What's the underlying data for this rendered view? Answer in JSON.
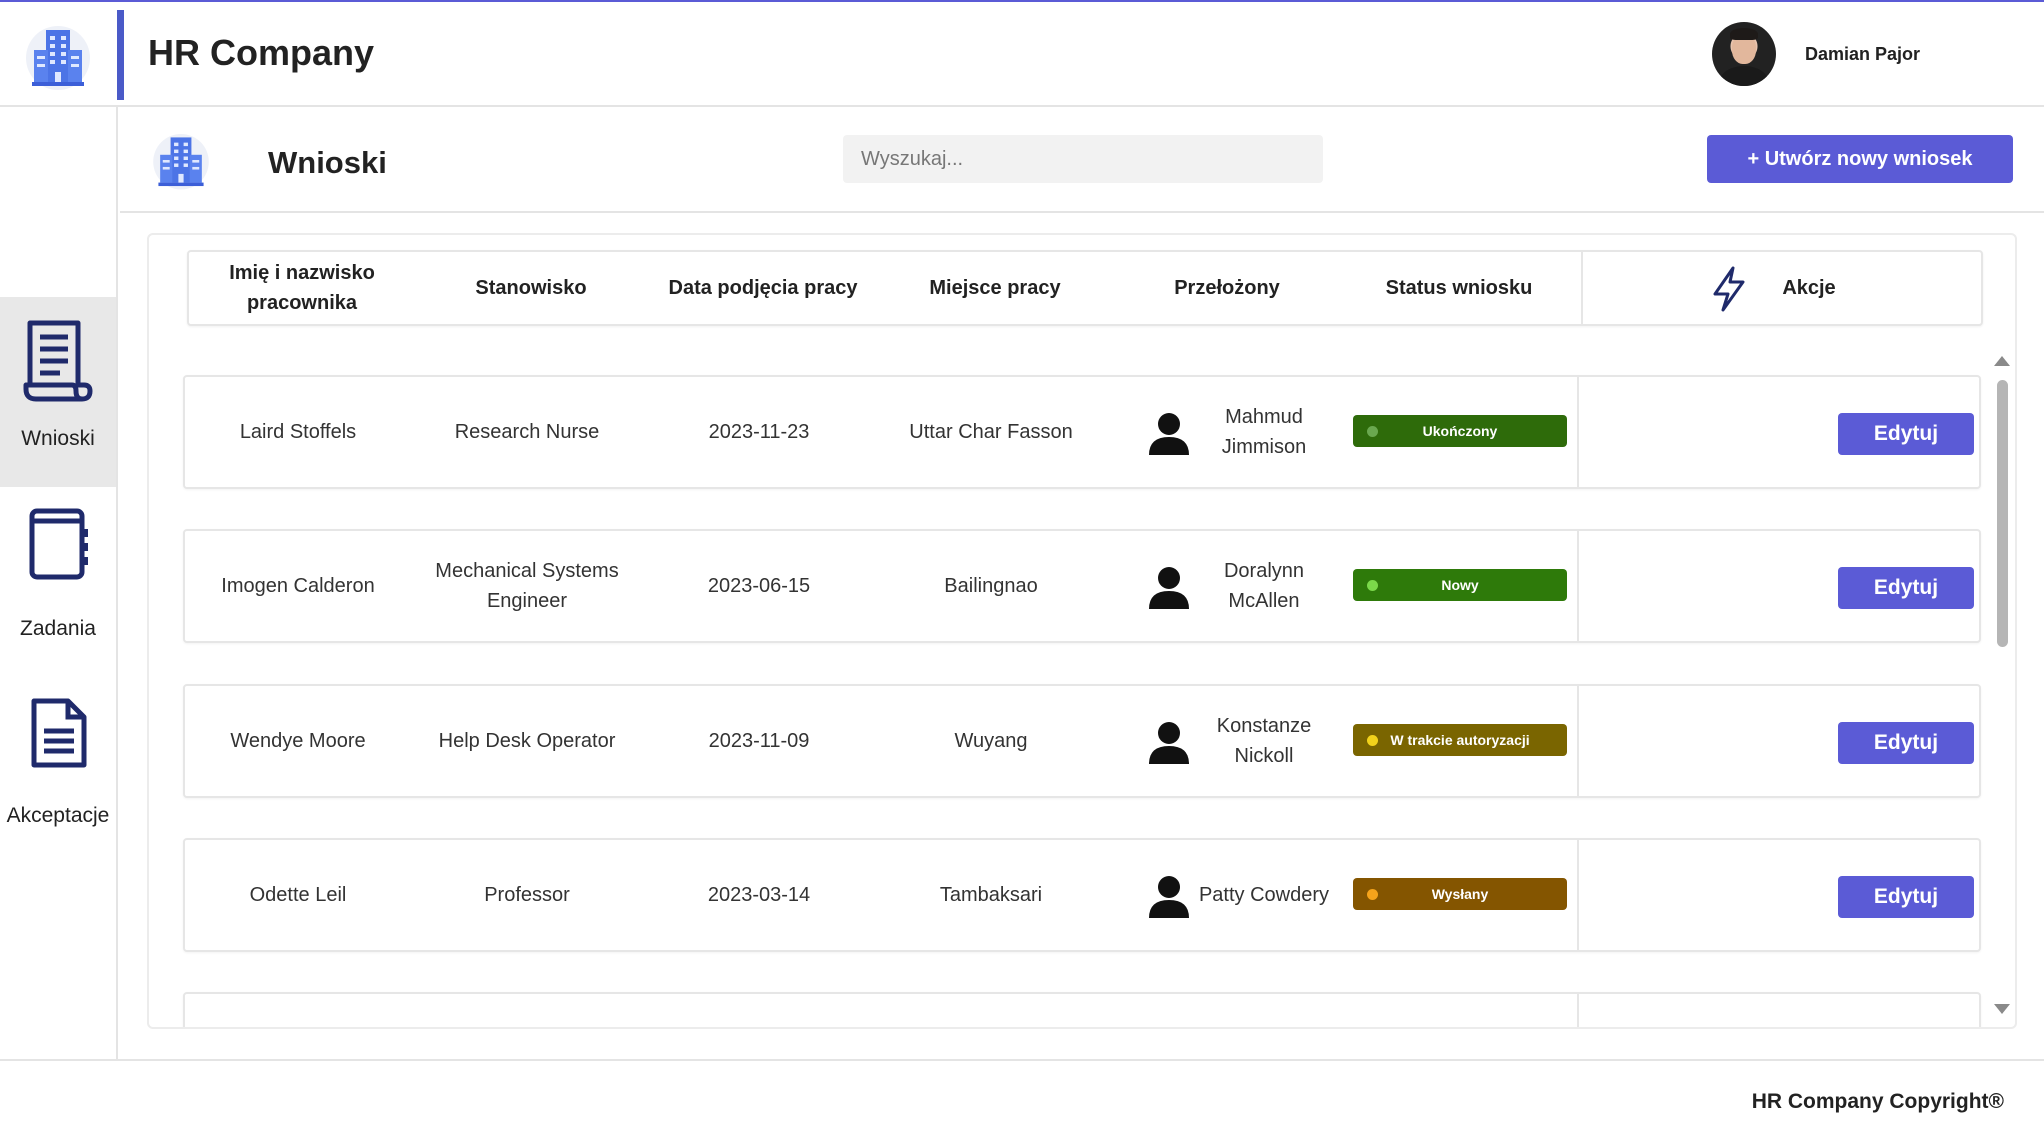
{
  "header": {
    "title": "HR Company",
    "user_name": "Damian Pajor"
  },
  "sidebar": {
    "items": [
      {
        "label": "Wnioski",
        "icon": "document-scroll-icon",
        "active": true
      },
      {
        "label": "Zadania",
        "icon": "notebook-icon",
        "active": false
      },
      {
        "label": "Akceptacje",
        "icon": "file-lines-icon",
        "active": false
      }
    ]
  },
  "page": {
    "title": "Wnioski",
    "search_placeholder": "Wyszukaj...",
    "new_button": "+ Utwórz nowy wniosek"
  },
  "table": {
    "headers": [
      "Imię i nazwisko pracownika",
      "Stanowisko",
      "Data podjęcia pracy",
      "Miejsce pracy",
      "Przełożony",
      "Status wniosku",
      "Akcje"
    ],
    "edit_label": "Edytuj",
    "rows": [
      {
        "name": "Laird Stoffels",
        "position": "Research Nurse",
        "date": "2023-11-23",
        "place": "Uttar Char Fasson",
        "supervisor": "Mahmud Jimmison",
        "status": "Ukończony",
        "status_bg": "#2e6b0a",
        "status_dot": "#6aa84f"
      },
      {
        "name": "Imogen Calderon",
        "position": "Mechanical Systems Engineer",
        "date": "2023-06-15",
        "place": "Bailingnao",
        "supervisor": "Doralynn McAllen",
        "status": "Nowy",
        "status_bg": "#2e7a0a",
        "status_dot": "#7bd84a"
      },
      {
        "name": "Wendye Moore",
        "position": "Help Desk Operator",
        "date": "2023-11-09",
        "place": "Wuyang",
        "supervisor": "Konstanze Nickoll",
        "status": "W trakcie autoryzacji",
        "status_bg": "#7a6500",
        "status_dot": "#f2d21b"
      },
      {
        "name": "Odette Leil",
        "position": "Professor",
        "date": "2023-03-14",
        "place": "Tambaksari",
        "supervisor": "Patty Cowdery",
        "status": "Wysłany",
        "status_bg": "#845500",
        "status_dot": "#f5a31b"
      }
    ]
  },
  "footer": {
    "text": "HR Company Copyright®"
  },
  "colors": {
    "accent": "#5b5bd6",
    "header_bar": "#4a5ac8",
    "icon_navy": "#1f2a6b"
  }
}
